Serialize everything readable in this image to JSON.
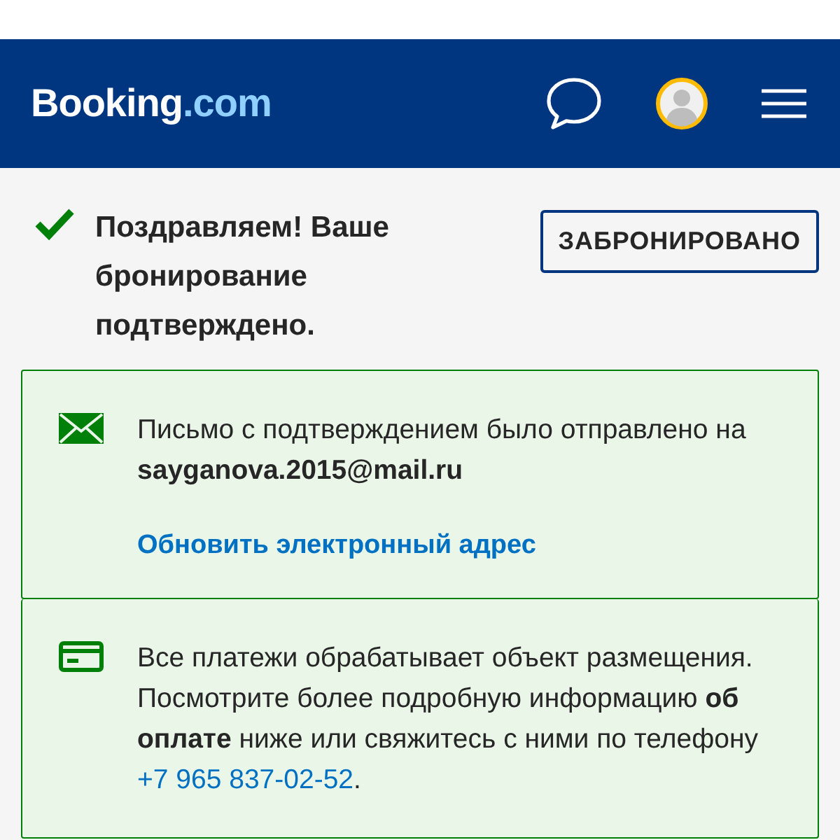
{
  "header": {
    "logo_main": "Booking",
    "logo_suffix": ".com"
  },
  "confirmation": {
    "title": "Поздравляем! Ваше бронирование подтверждено.",
    "status": "ЗАБРОНИРОВАНО"
  },
  "email_card": {
    "text": "Письмо с подтверждением было отправлено на **sayganova.2015@mail.ru**",
    "link": "Обновить электронный адрес"
  },
  "payment_card": {
    "text_before": "Все платежи обрабатывает объект размещения. Посмотрите более подробную информацию **об оплате** ниже или свяжитесь с ними по телефону ",
    "phone": "+7 965 837-02-52",
    "text_after": "."
  }
}
